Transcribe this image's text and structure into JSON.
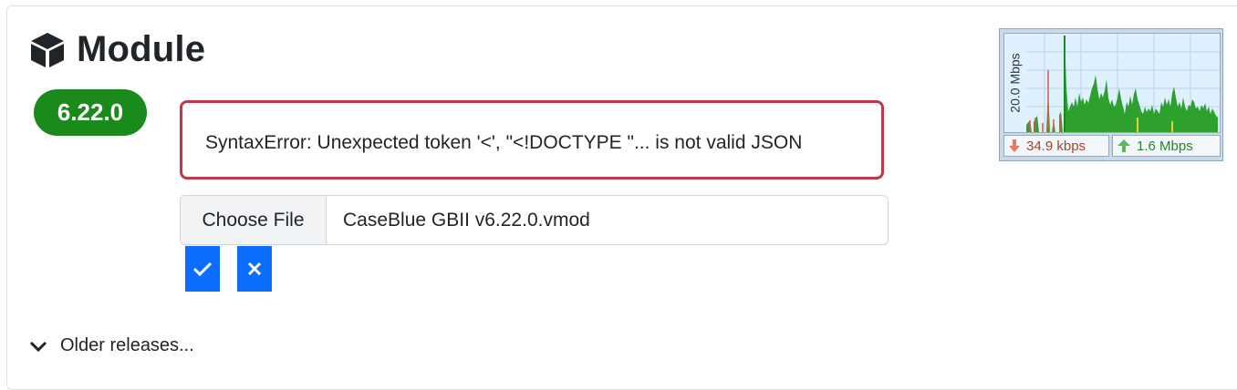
{
  "module": {
    "title": "Module",
    "version": "6.22.0",
    "icon": "cube-icon"
  },
  "error": {
    "message": "SyntaxError: Unexpected token '<', \"<!DOCTYPE \"... is not valid JSON",
    "border_color": "#c0394b"
  },
  "file_input": {
    "button_label": "Choose File",
    "file_name": "CaseBlue GBII v6.22.0.vmod"
  },
  "actions": {
    "confirm_icon": "check-icon",
    "cancel_icon": "close-icon",
    "color": "#0d6efd"
  },
  "older_releases": {
    "label": "Older releases...",
    "icon": "chevron-down-icon"
  },
  "net_meter": {
    "axis_label": "20.0 Mbps",
    "download": "34.9 kbps",
    "upload": "1.6 Mbps",
    "download_color": "#a0452a",
    "upload_color": "#2d7f2d"
  },
  "colors": {
    "badge": "#1a8a1a"
  }
}
